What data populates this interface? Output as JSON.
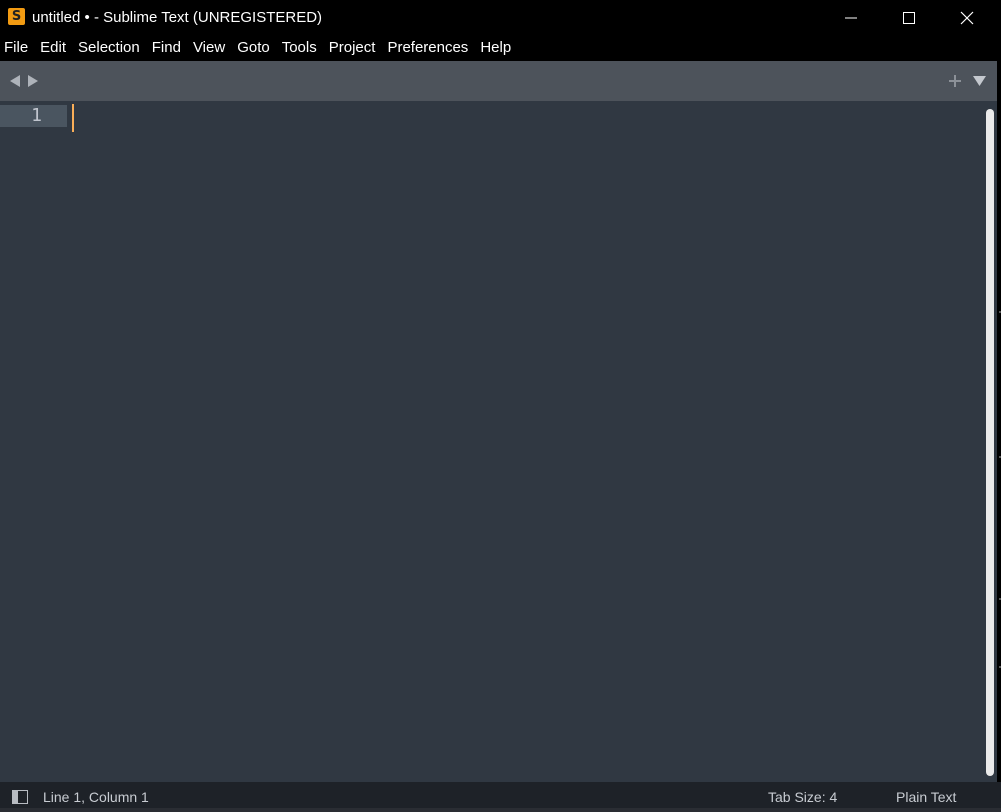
{
  "window": {
    "title": "untitled • - Sublime Text (UNREGISTERED)",
    "icon_glyph": "S"
  },
  "menu": [
    "File",
    "Edit",
    "Selection",
    "Find",
    "View",
    "Goto",
    "Tools",
    "Project",
    "Preferences",
    "Help"
  ],
  "editor": {
    "line_number": "1",
    "content": ""
  },
  "status": {
    "position": "Line 1, Column 1",
    "tab_size": "Tab Size: 4",
    "syntax": "Plain Text"
  },
  "colors": {
    "editor_bg": "#303842",
    "tabstrip_bg": "#4d535b",
    "caret": "#f9ae58",
    "statusbar_bg": "#1e2228"
  },
  "icons": {
    "app": "sublime-logo-icon",
    "minimize": "minimize-icon",
    "maximize": "maximize-icon",
    "close": "close-icon",
    "nav_back": "tab-back-icon",
    "nav_forward": "tab-forward-icon",
    "new_tab": "plus-icon",
    "tab_list": "triangle-down-icon",
    "sidebar": "sidebar-toggle-icon"
  }
}
